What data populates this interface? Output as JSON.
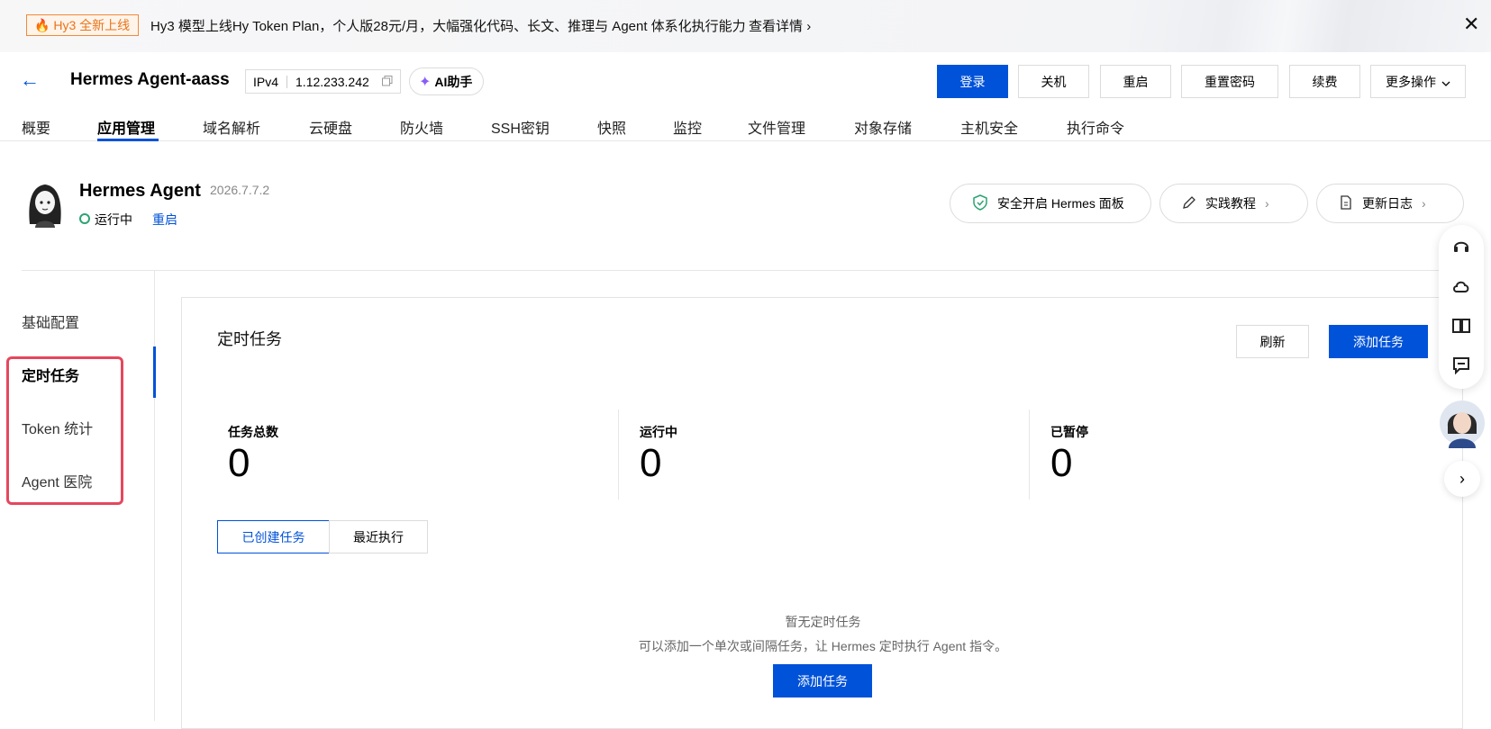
{
  "banner": {
    "badge": "Hy3 全新上线",
    "text": "Hy3 模型上线Hy Token Plan，个人版28元/月，大幅强化代码、长文、推理与 Agent 体系化执行能力",
    "link": "查看详情"
  },
  "header": {
    "title": "Hermes Agent-aass",
    "ip_type": "IPv4",
    "ip": "1.12.233.242",
    "ai_label": "AI助手",
    "buttons": {
      "login": "登录",
      "shutdown": "关机",
      "restart": "重启",
      "reset_pwd": "重置密码",
      "renew": "续费",
      "more": "更多操作"
    }
  },
  "tabs": [
    "概要",
    "应用管理",
    "域名解析",
    "云硬盘",
    "防火墙",
    "SSH密钥",
    "快照",
    "监控",
    "文件管理",
    "对象存储",
    "主机安全",
    "执行命令"
  ],
  "app": {
    "name": "Hermes Agent",
    "version": "2026.7.7.2",
    "status": "运行中",
    "restart": "重启",
    "panel_btn": "安全开启 Hermes 面板",
    "tutorial_btn": "实践教程",
    "changelog_btn": "更新日志"
  },
  "sidebar": [
    "基础配置",
    "定时任务",
    "Token 统计",
    "Agent 医院"
  ],
  "main": {
    "title": "定时任务",
    "refresh": "刷新",
    "add": "添加任务",
    "stats": [
      {
        "label": "任务总数",
        "value": "0"
      },
      {
        "label": "运行中",
        "value": "0"
      },
      {
        "label": "已暂停",
        "value": "0"
      }
    ],
    "segments": [
      "已创建任务",
      "最近执行"
    ],
    "empty_title": "暂无定时任务",
    "empty_desc": "可以添加一个单次或间隔任务，让 Hermes 定时执行 Agent 指令。",
    "empty_add": "添加任务"
  },
  "colors": {
    "primary": "#0052d9",
    "badge": "#e8741a",
    "highlight": "#e5475d",
    "running": "#2ba471"
  }
}
